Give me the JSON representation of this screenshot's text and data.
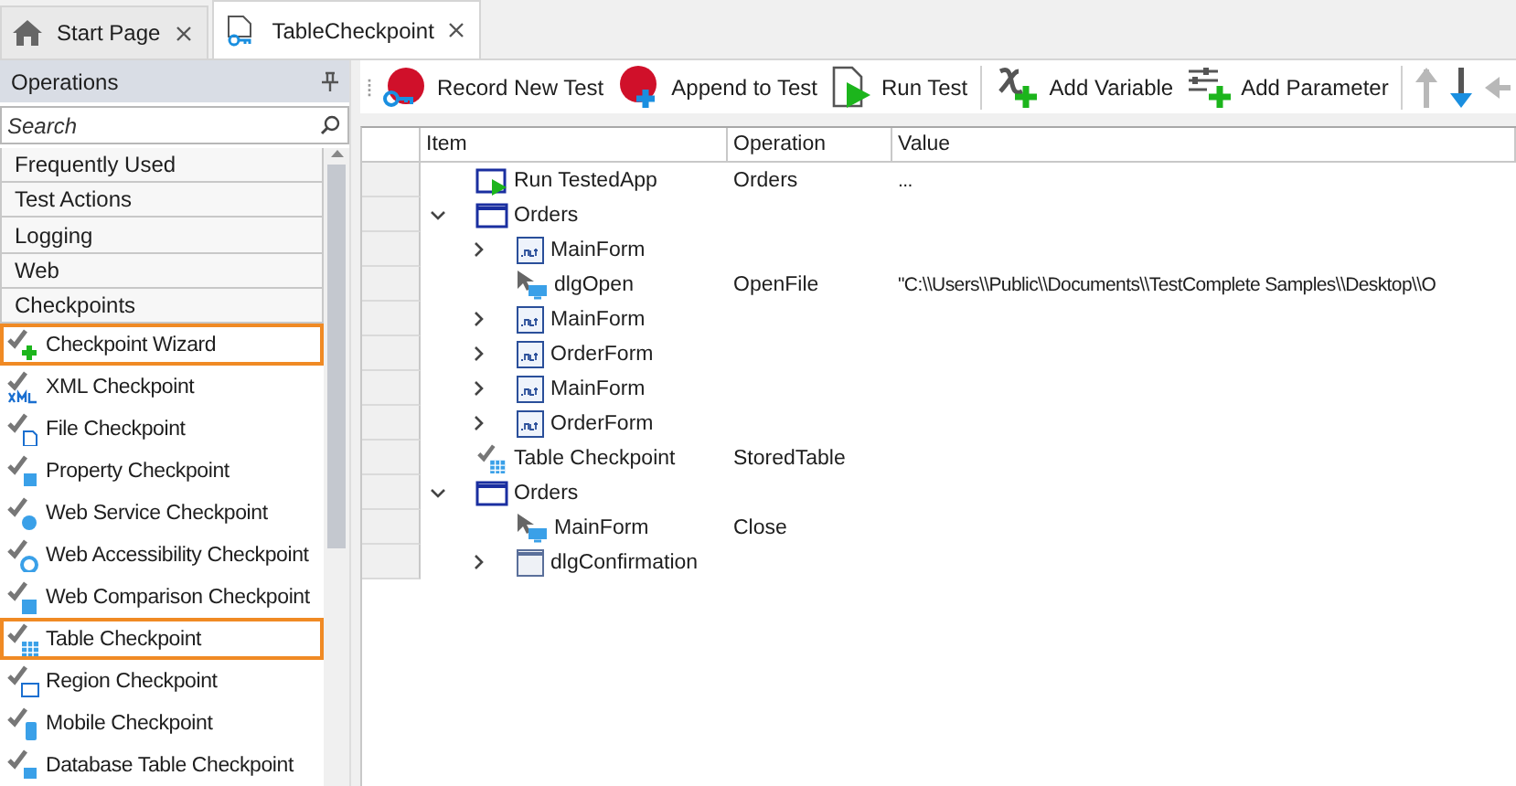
{
  "tabs": [
    {
      "label": "Start Page",
      "kind": "home",
      "selected": false
    },
    {
      "label": "TableCheckpoint",
      "kind": "test",
      "selected": true
    }
  ],
  "operations_panel": {
    "title": "Operations",
    "search": {
      "placeholder": "Search"
    },
    "categories": [
      "Frequently Used",
      "Test Actions",
      "Logging",
      "Web",
      "Checkpoints"
    ],
    "items": [
      {
        "label": "Checkpoint Wizard",
        "kind": "wizard",
        "highlighted": true
      },
      {
        "label": "XML Checkpoint",
        "kind": "xml",
        "highlighted": false
      },
      {
        "label": "File Checkpoint",
        "kind": "file",
        "highlighted": false
      },
      {
        "label": "Property Checkpoint",
        "kind": "property",
        "highlighted": false
      },
      {
        "label": "Web Service Checkpoint",
        "kind": "webservice",
        "highlighted": false
      },
      {
        "label": "Web Accessibility Checkpoint",
        "kind": "webaccess",
        "highlighted": false
      },
      {
        "label": "Web Comparison Checkpoint",
        "kind": "webcompare",
        "highlighted": false
      },
      {
        "label": "Table Checkpoint",
        "kind": "table",
        "highlighted": true
      },
      {
        "label": "Region Checkpoint",
        "kind": "region",
        "highlighted": false
      },
      {
        "label": "Mobile Checkpoint",
        "kind": "mobile",
        "highlighted": false
      },
      {
        "label": "Database Table Checkpoint",
        "kind": "database",
        "highlighted": false
      }
    ]
  },
  "toolbar": [
    {
      "label": "Record New Test",
      "kind": "record"
    },
    {
      "label": "Append to Test",
      "kind": "append"
    },
    {
      "label": "Run Test",
      "kind": "run"
    },
    {
      "kind": "separator"
    },
    {
      "label": "Add Variable",
      "kind": "variable"
    },
    {
      "label": "Add Parameter",
      "kind": "parameter"
    },
    {
      "kind": "separator"
    },
    {
      "kind": "up",
      "disabled": true
    },
    {
      "kind": "down",
      "disabled": false
    },
    {
      "kind": "left",
      "disabled": true
    }
  ],
  "grid": {
    "columns": [
      "Item",
      "Operation",
      "Value"
    ],
    "rows": [
      {
        "item": "Run TestedApp",
        "kind": "run",
        "operation": "Orders",
        "value": "..."
      },
      {
        "item": "Orders",
        "kind": "window",
        "expanded": true,
        "children": [
          {
            "item": "MainForm",
            "kind": "net",
            "expanded": false
          },
          {
            "item": "dlgOpen",
            "kind": "onscreen",
            "operation": "OpenFile",
            "value": "\"C:\\\\Users\\\\Public\\\\Documents\\\\TestComplete Samples\\\\Desktop\\\\O"
          },
          {
            "item": "MainForm",
            "kind": "net",
            "expanded": false
          },
          {
            "item": "OrderForm",
            "kind": "net",
            "expanded": false
          },
          {
            "item": "MainForm",
            "kind": "net",
            "expanded": false
          },
          {
            "item": "OrderForm",
            "kind": "net",
            "expanded": false
          }
        ]
      },
      {
        "item": "Table Checkpoint",
        "kind": "table",
        "operation": "StoredTable"
      },
      {
        "item": "Orders",
        "kind": "window",
        "expanded": true,
        "children": [
          {
            "item": "MainForm",
            "kind": "onscreen",
            "operation": "Close"
          },
          {
            "item": "dlgConfirmation",
            "kind": "dialog",
            "expanded": false
          }
        ]
      }
    ]
  }
}
